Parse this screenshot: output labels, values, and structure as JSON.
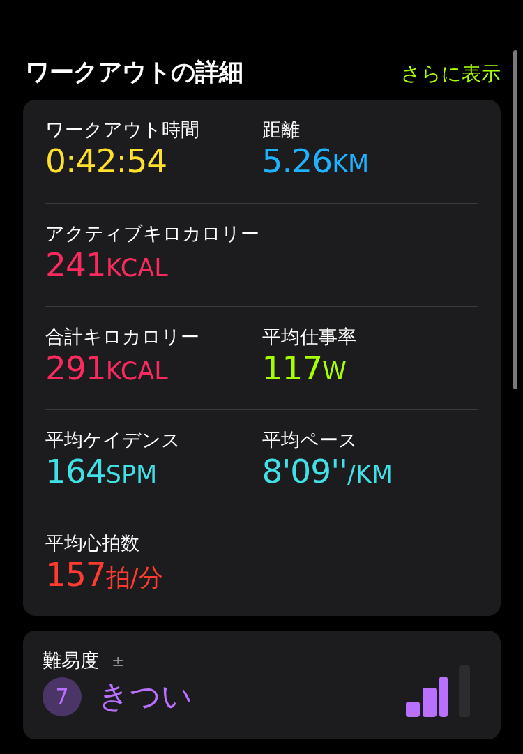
{
  "header": {
    "title": "ワークアウトの詳細",
    "link": "さらに表示"
  },
  "metric_rows": [
    {
      "metrics": [
        {
          "label": "ワークアウト時間",
          "value": "0:42:54",
          "color": "#ffe02e"
        },
        {
          "label": "距離",
          "value": "5.26",
          "unit": "KM",
          "color": "#1fb2ff"
        }
      ]
    },
    {
      "metrics": [
        {
          "label": "アクティブキロカロリー",
          "value": "241",
          "unit": "KCAL",
          "color": "#fa2a5e"
        }
      ]
    },
    {
      "metrics": [
        {
          "label": "合計キロカロリー",
          "value": "291",
          "unit": "KCAL",
          "color": "#fa2a5e"
        },
        {
          "label": "平均仕事率",
          "value": "117",
          "unit": "W",
          "color": "#a6ff00"
        }
      ]
    },
    {
      "metrics": [
        {
          "label": "平均ケイデンス",
          "value": "164",
          "unit": "SPM",
          "color": "#40e0e6"
        },
        {
          "label": "平均ペース",
          "value": "8'09''",
          "unit": "/KM",
          "color": "#40e0e6"
        }
      ]
    },
    {
      "metrics": [
        {
          "label": "平均心拍数",
          "value": "157",
          "unit": "拍/分",
          "color": "#ff3b2f"
        }
      ]
    }
  ],
  "effort": {
    "label": "難易度",
    "adjust": "±",
    "score": "7",
    "rating": "きつい",
    "level": 0.75
  }
}
